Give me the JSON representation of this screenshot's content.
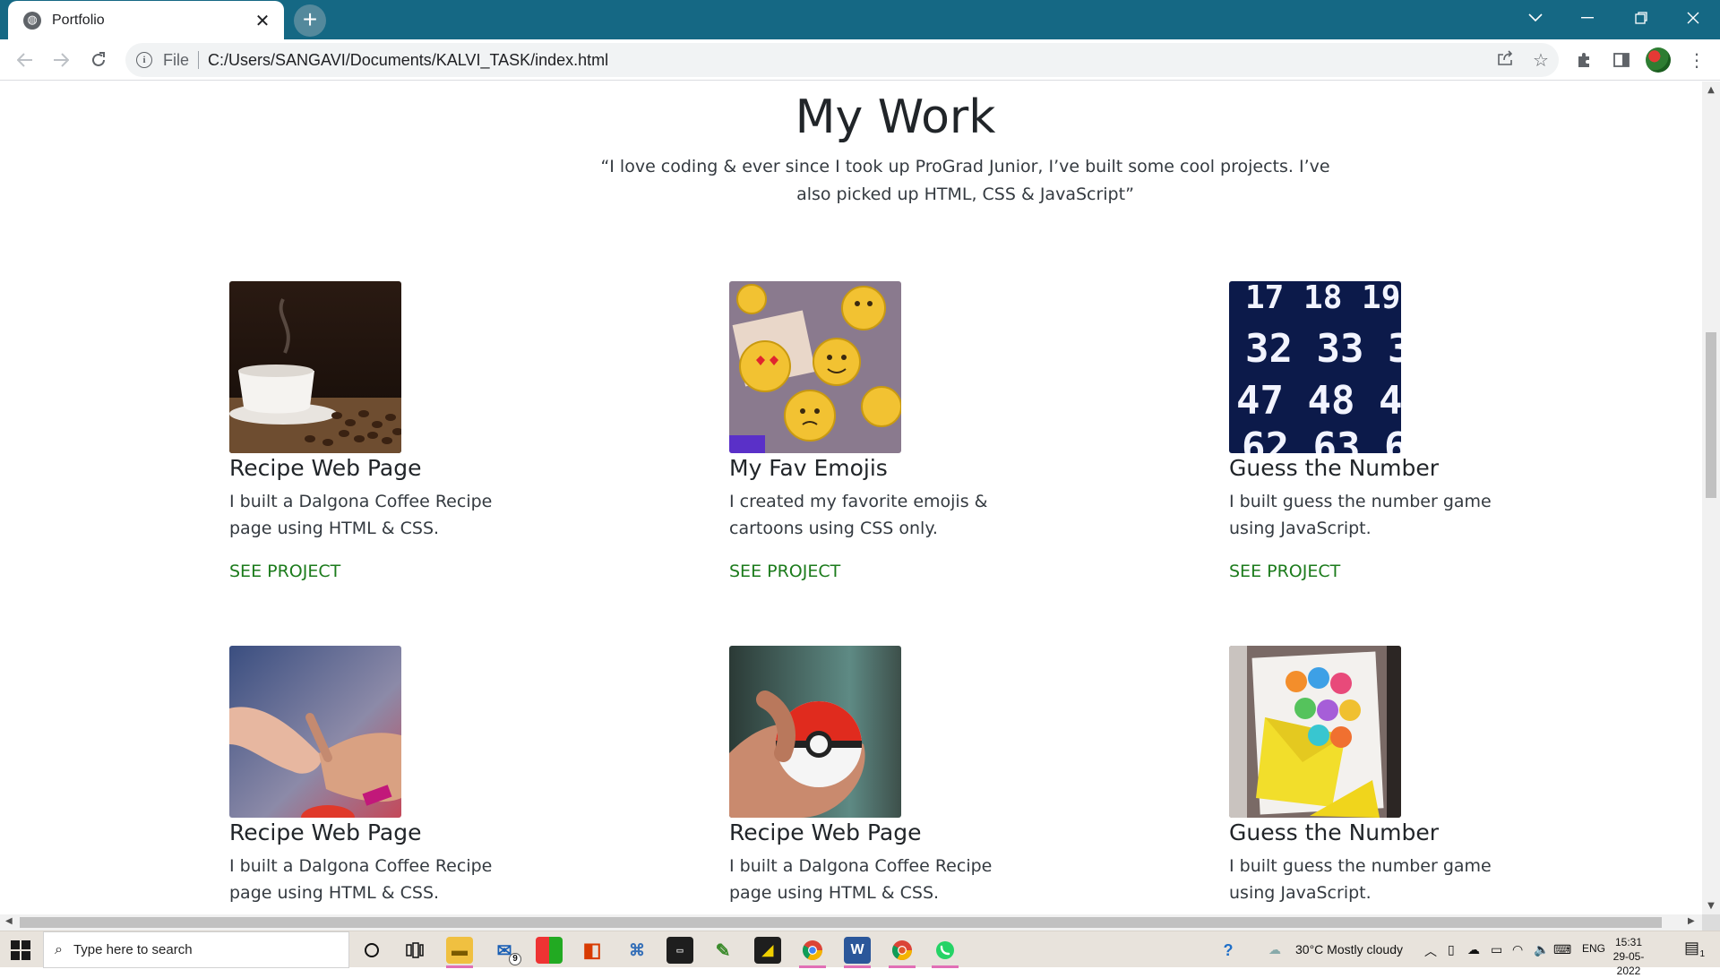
{
  "browser": {
    "tab_title": "Portfolio",
    "url_scheme": "File",
    "url": "C:/Users/SANGAVI/Documents/KALVI_TASK/index.html"
  },
  "page": {
    "heading": "My Work",
    "quote": "“I love coding & ever since I took up ProGrad Junior, I’ve built some cool projects. I’ve also picked up HTML, CSS & JavaScript”",
    "link_label": "SEE PROJECT",
    "cards": [
      {
        "title": "Recipe Web Page",
        "desc": "I built a Dalgona Coffee Recipe page using HTML & CSS.",
        "image": "coffee-cup-image"
      },
      {
        "title": "My Fav Emojis",
        "desc": "I created my favorite emojis & cartoons using CSS only.",
        "image": "emoji-pillows-image"
      },
      {
        "title": "Guess the Number",
        "desc": "I built guess the number game using JavaScript.",
        "image": "number-board-image"
      },
      {
        "title": "Recipe Web Page",
        "desc": "I built a Dalgona Coffee Recipe page using HTML & CSS.",
        "image": "hands-image"
      },
      {
        "title": "Recipe Web Page",
        "desc": "I built a Dalgona Coffee Recipe page using HTML & CSS.",
        "image": "pokeball-image"
      },
      {
        "title": "Guess the Number",
        "desc": "I built guess the number game using JavaScript.",
        "image": "birthday-card-image"
      }
    ]
  },
  "taskbar": {
    "search_placeholder": "Type here to search",
    "mail_badge": "9",
    "weather": "30°C  Mostly cloudy",
    "language": "ENG",
    "time": "15:31",
    "date": "29-05-2022",
    "notification_count": "1"
  }
}
